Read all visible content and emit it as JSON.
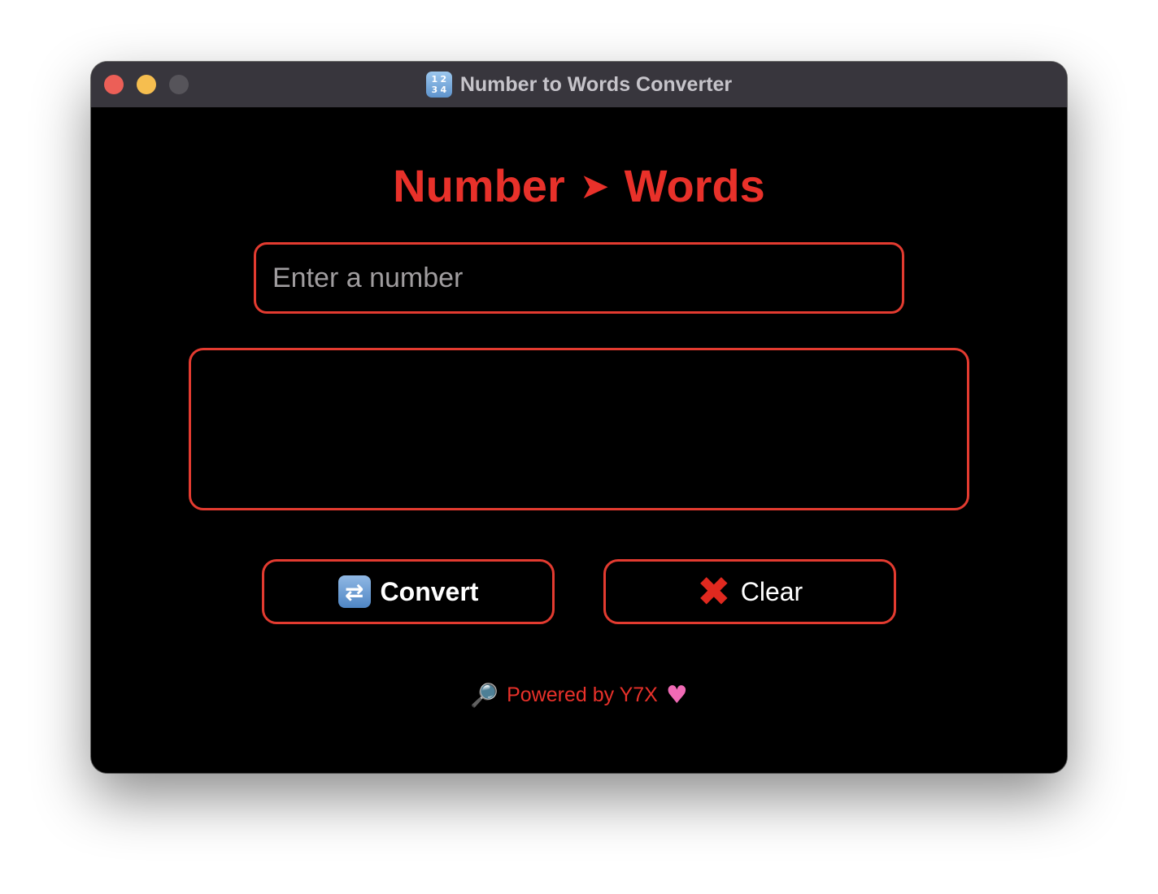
{
  "window": {
    "title": "Number to Words Converter",
    "icon": "number-keypad-icon",
    "icon_digits": [
      "1",
      "2",
      "3",
      "4"
    ]
  },
  "main": {
    "heading_left": "Number",
    "heading_arrow": "➤",
    "heading_right": "Words",
    "input": {
      "placeholder": "Enter a number",
      "value": ""
    },
    "output": {
      "text": ""
    },
    "convert_button": {
      "icon": "repeat-icon",
      "icon_glyph": "⇄",
      "label": "Convert"
    },
    "clear_button": {
      "icon": "cross-mark-icon",
      "icon_glyph": "✖",
      "label": "Clear"
    },
    "footer": {
      "leading_icon": "magnifier-icon",
      "leading_glyph": "🔎",
      "text": "Powered by Y7X",
      "trailing_icon": "heart-icon",
      "trailing_glyph": "♥"
    }
  },
  "colors": {
    "accent": "#e8312a",
    "window_background": "#000000",
    "titlebar": "#38363d"
  }
}
